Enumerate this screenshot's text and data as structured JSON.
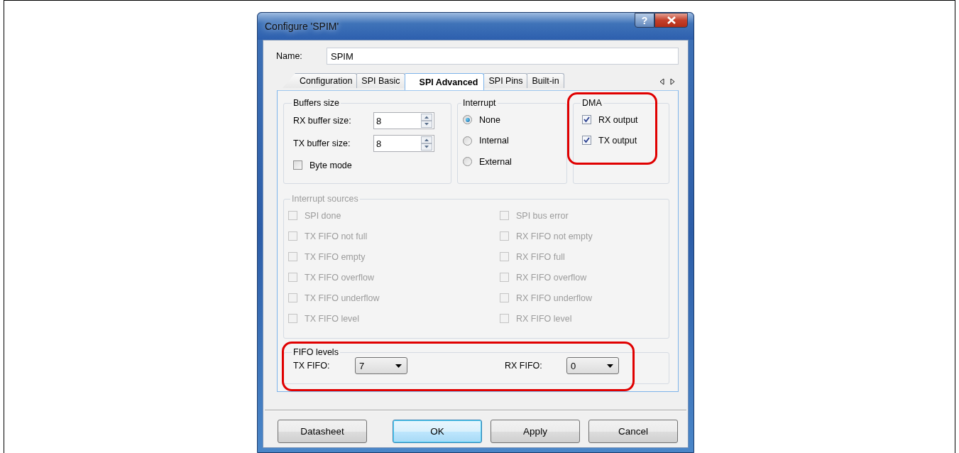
{
  "window": {
    "title": "Configure 'SPIM'",
    "help": "?"
  },
  "name_field": {
    "label": "Name:",
    "value": "SPIM"
  },
  "tabs": [
    {
      "label": "Configuration",
      "selected": false
    },
    {
      "label": "SPI Basic",
      "selected": false
    },
    {
      "label": "SPI Advanced",
      "selected": true
    },
    {
      "label": "SPI Pins",
      "selected": false
    },
    {
      "label": "Built-in",
      "selected": false
    }
  ],
  "buffers": {
    "title": "Buffers size",
    "fields": [
      {
        "label": "RX buffer size:",
        "value": "8"
      },
      {
        "label": "TX buffer size:",
        "value": "8"
      }
    ],
    "byte_mode": {
      "label": "Byte mode",
      "checked": false
    }
  },
  "interrupt": {
    "title": "Interrupt",
    "options": [
      {
        "label": "None",
        "selected": true
      },
      {
        "label": "Internal",
        "selected": false
      },
      {
        "label": "External",
        "selected": false
      }
    ]
  },
  "dma": {
    "title": "DMA",
    "highlighted": true,
    "items": [
      {
        "label": "RX output",
        "checked": true
      },
      {
        "label": "TX output",
        "checked": true
      }
    ]
  },
  "interrupt_sources": {
    "title": "Interrupt sources",
    "disabled": true,
    "items": [
      {
        "label": "SPI done",
        "checked": false
      },
      {
        "label": "SPI bus error",
        "checked": false
      },
      {
        "label": "TX FIFO not full",
        "checked": false
      },
      {
        "label": "RX FIFO not empty",
        "checked": false
      },
      {
        "label": "TX FIFO empty",
        "checked": false
      },
      {
        "label": "RX FIFO full",
        "checked": false
      },
      {
        "label": "TX FIFO overflow",
        "checked": false
      },
      {
        "label": "RX FIFO overflow",
        "checked": false
      },
      {
        "label": "TX FIFO underflow",
        "checked": false
      },
      {
        "label": "RX FIFO underflow",
        "checked": false
      },
      {
        "label": "TX FIFO level",
        "checked": false
      },
      {
        "label": "RX FIFO level",
        "checked": false
      }
    ]
  },
  "fifo_levels": {
    "title": "FIFO levels",
    "highlighted": true,
    "fields": [
      {
        "label": "TX FIFO:",
        "value": "7"
      },
      {
        "label": "RX FIFO:",
        "value": "0"
      }
    ]
  },
  "buttons": [
    {
      "label": "Datasheet",
      "default": false
    },
    {
      "label": "OK",
      "default": true
    },
    {
      "label": "Apply",
      "default": false
    },
    {
      "label": "Cancel",
      "default": false
    }
  ]
}
